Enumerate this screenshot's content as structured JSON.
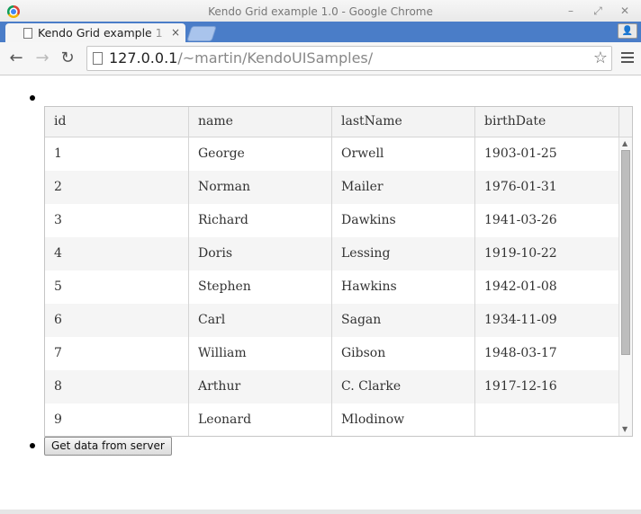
{
  "window": {
    "title": "Kendo Grid example 1.0 - Google Chrome"
  },
  "tab": {
    "title": "Kendo Grid example 1.0",
    "close": "×"
  },
  "address": {
    "host": "127.0.0.1",
    "path": "/~martin/KendoUISamples/"
  },
  "grid": {
    "columns": [
      "id",
      "name",
      "lastName",
      "birthDate"
    ],
    "rows": [
      {
        "id": "1",
        "name": "George",
        "lastName": "Orwell",
        "birthDate": "1903-01-25"
      },
      {
        "id": "2",
        "name": "Norman",
        "lastName": "Mailer",
        "birthDate": "1976-01-31"
      },
      {
        "id": "3",
        "name": "Richard",
        "lastName": "Dawkins",
        "birthDate": "1941-03-26"
      },
      {
        "id": "4",
        "name": "Doris",
        "lastName": "Lessing",
        "birthDate": "1919-10-22"
      },
      {
        "id": "5",
        "name": "Stephen",
        "lastName": "Hawkins",
        "birthDate": "1942-01-08"
      },
      {
        "id": "6",
        "name": "Carl",
        "lastName": "Sagan",
        "birthDate": "1934-11-09"
      },
      {
        "id": "7",
        "name": "William",
        "lastName": "Gibson",
        "birthDate": "1948-03-17"
      },
      {
        "id": "8",
        "name": "Arthur",
        "lastName": "C. Clarke",
        "birthDate": "1917-12-16"
      },
      {
        "id": "9",
        "name": "Leonard",
        "lastName": "Mlodinow",
        "birthDate": ""
      }
    ]
  },
  "actions": {
    "get_data_label": "Get data from server"
  },
  "icons": {
    "back": "back-arrow-icon",
    "forward": "forward-arrow-icon",
    "reload": "reload-icon",
    "bookmark": "star-icon",
    "menu": "hamburger-menu-icon",
    "profile": "profile-icon",
    "minimize": "minimize-icon",
    "maximize": "maximize-icon",
    "close": "close-icon"
  }
}
